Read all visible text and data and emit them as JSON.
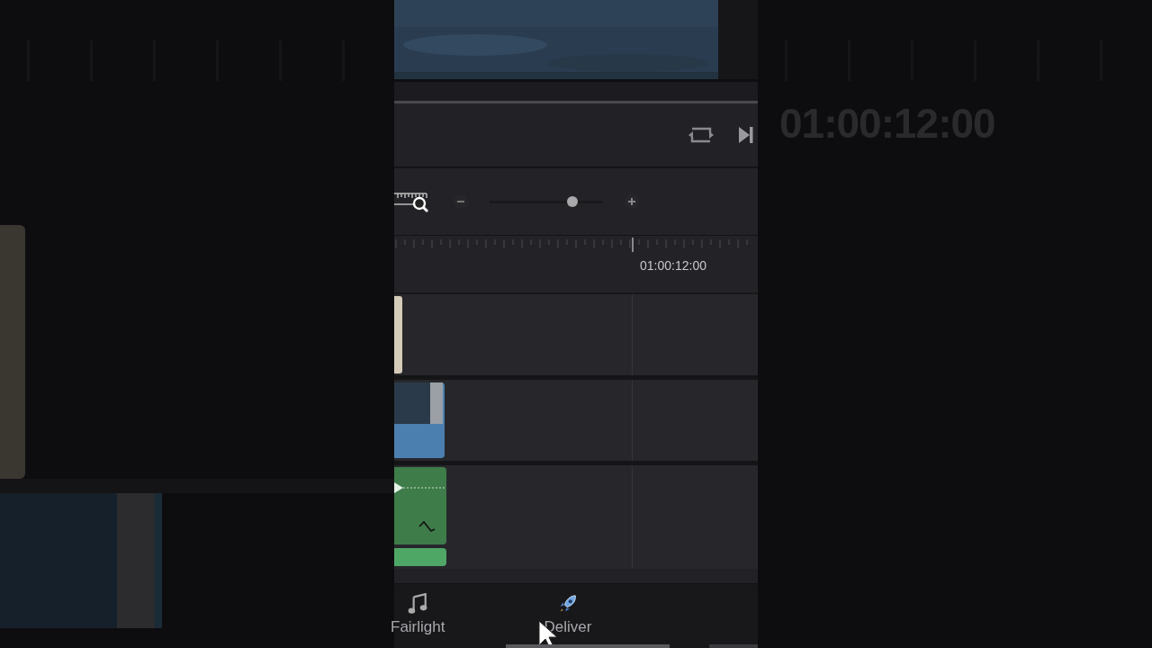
{
  "background_timecode": "01:00:12:00",
  "zoom": {
    "level": 0.73
  },
  "ruler": {
    "timecode": "01:00:12:00"
  },
  "page_tabs": [
    {
      "label": "Fairlight",
      "kind": "audio"
    },
    {
      "label": "Deliver",
      "kind": "export"
    }
  ]
}
